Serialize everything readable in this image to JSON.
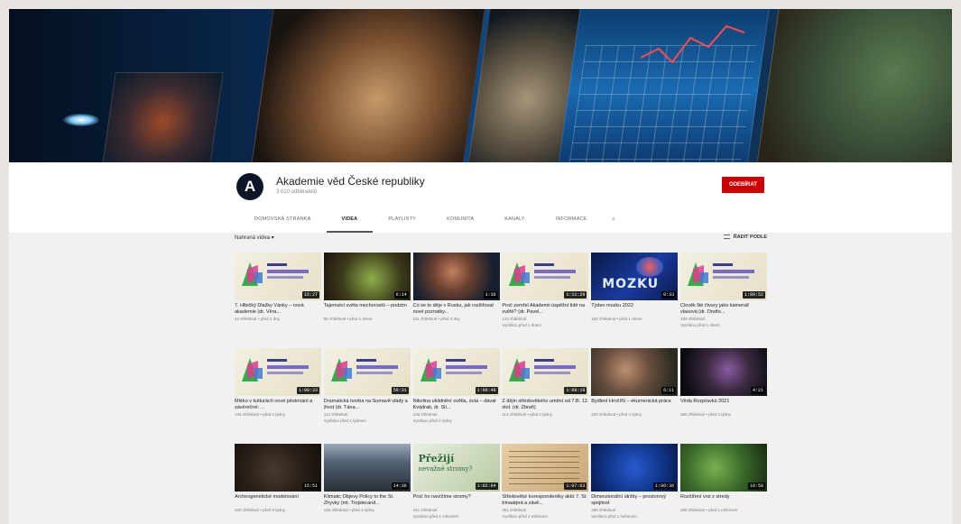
{
  "channel": {
    "name": "Akademie věd České republiky",
    "subscribers": "3 010 odběratelů",
    "avatar_letter": "A",
    "subscribe_label": "ODEBÍRAT",
    "subscribe_color": "#cc0000"
  },
  "tabs": [
    {
      "label": "DOMOVSKÁ STRÁNKA",
      "active": false
    },
    {
      "label": "VIDEA",
      "active": true
    },
    {
      "label": "PLAYLISTY",
      "active": false
    },
    {
      "label": "KOMUNITA",
      "active": false
    },
    {
      "label": "KANÁLY",
      "active": false
    },
    {
      "label": "INFORMACE",
      "active": false
    },
    {
      "label": "⌕",
      "active": false
    }
  ],
  "toolbar": {
    "uploads_label": "Nahraná videa ▾",
    "sort_label": "ŘADIT PODLE"
  },
  "videos": [
    {
      "title": "7. Hlbičký Dlažky Vánky – nová akademie (dr. Věra...",
      "meta": "42 zhlédnutí • před 2 dny",
      "meta2": "",
      "duration": "15:27",
      "thumb": "promo"
    },
    {
      "title": "Tajemství světa mechorostů – podzim",
      "meta": "86 zhlédnutí • před 1 dnem",
      "meta2": "",
      "duration": "6:14",
      "thumb": "green"
    },
    {
      "title": "Co se to děje v Rusku, jak rozšiřovat nové poznatky...",
      "meta": "211 zhlédnutí • před 3 dny",
      "meta2": "",
      "duration": "1:36",
      "thumb": "person"
    },
    {
      "title": "Proč zemřel Akademii úspěšní lidé na světě? (dr. Pavel...",
      "meta": "124 zhlédnutí",
      "meta2": "Vysíláno před 1 dnem",
      "duration": "1:11:29",
      "thumb": "promo"
    },
    {
      "title": "Týden mozku 2022",
      "meta": "102 zhlédnutí • před 1 dnem",
      "meta2": "",
      "duration": "0:33",
      "thumb": "brain"
    },
    {
      "title": "Člověk lité čtvery jako kamenář vlasová (dr. Ondře...",
      "meta": "193 zhlédnutí",
      "meta2": "Vysíláno před 1 dnem",
      "duration": "1:09:52",
      "thumb": "promo"
    },
    {
      "title": "Mléko v kulturách nové pěstování a závěrečné: ...",
      "meta": "145 zhlédnutí • před 2 týdny",
      "meta2": "",
      "duration": "1:08:33",
      "thumb": "promo"
    },
    {
      "title": "Dramatická tvorba na Sumavě vlády a život (dr. Tána...",
      "meta": "113 zhlédnutí",
      "meta2": "Vysíláno před 1 týdnem",
      "duration": "59:31",
      "thumb": "promo"
    },
    {
      "title": "Nikolina uklidnění světla, úcta – dávat Kvádrati, dr. Slí...",
      "meta": "108 zhlédnutí",
      "meta2": "Vysíláno před 2 týdny",
      "duration": "1:06:48",
      "thumb": "promo"
    },
    {
      "title": "Z dějin středověkého umění od 7.B. 12. stol. (dr. Zbraň)",
      "meta": "114 zhlédnutí • před 2 týdny",
      "meta2": "",
      "duration": "1:08:19",
      "thumb": "promo"
    },
    {
      "title": "Bydlení Hrnčířů – ekumenická práce",
      "meta": "220 zhlédnutí • před 2 týdny",
      "meta2": "",
      "duration": "6:11",
      "thumb": "men"
    },
    {
      "title": "Věda Rozpravků 2021",
      "meta": "380 zhlédnutí • před 3 týdny",
      "meta2": "",
      "duration": "4:21",
      "thumb": "dark"
    },
    {
      "title": "Archeogenetické modelování",
      "meta": "330 zhlédnutí • před 3 týdny",
      "meta2": "",
      "duration": "15:51",
      "thumb": "drum"
    },
    {
      "title": "Klimatic Objevy Policy to the St. Zhyvky (mt. Trojsterand...",
      "meta": "155 zhlédnutí • před 4 týdny",
      "meta2": "",
      "duration": "14:36",
      "thumb": "people"
    },
    {
      "title": "Proč ho navržíme stromy?",
      "meta": "441 zhlédnutí",
      "meta2": "Vysíláno před 1 měsícem",
      "duration": "1:02:04",
      "thumb": "book"
    },
    {
      "title": "Středověké korespondentky aktů 7. St. trinaatprá a závě...",
      "meta": "351 zhlédnutí",
      "meta2": "Vysíláno před 1 měsícem",
      "duration": "1:07:03",
      "thumb": "paper"
    },
    {
      "title": "Dimenzionální útržky – prostorový spojitost",
      "meta": "398 zhlédnutí",
      "meta2": "Vysíláno před 1 měsícem",
      "duration": "1:06:36",
      "thumb": "space"
    },
    {
      "title": "Rozšíření vrsi z stredy",
      "meta": "280 zhlédnutí • před 1 měsícem",
      "meta2": "",
      "duration": "10:58",
      "thumb": "plants"
    }
  ],
  "thumb_texts": {
    "brain_word": "MOZKU",
    "book_word_1": "Přežijí",
    "book_word_2": "nevažné stromy?"
  }
}
